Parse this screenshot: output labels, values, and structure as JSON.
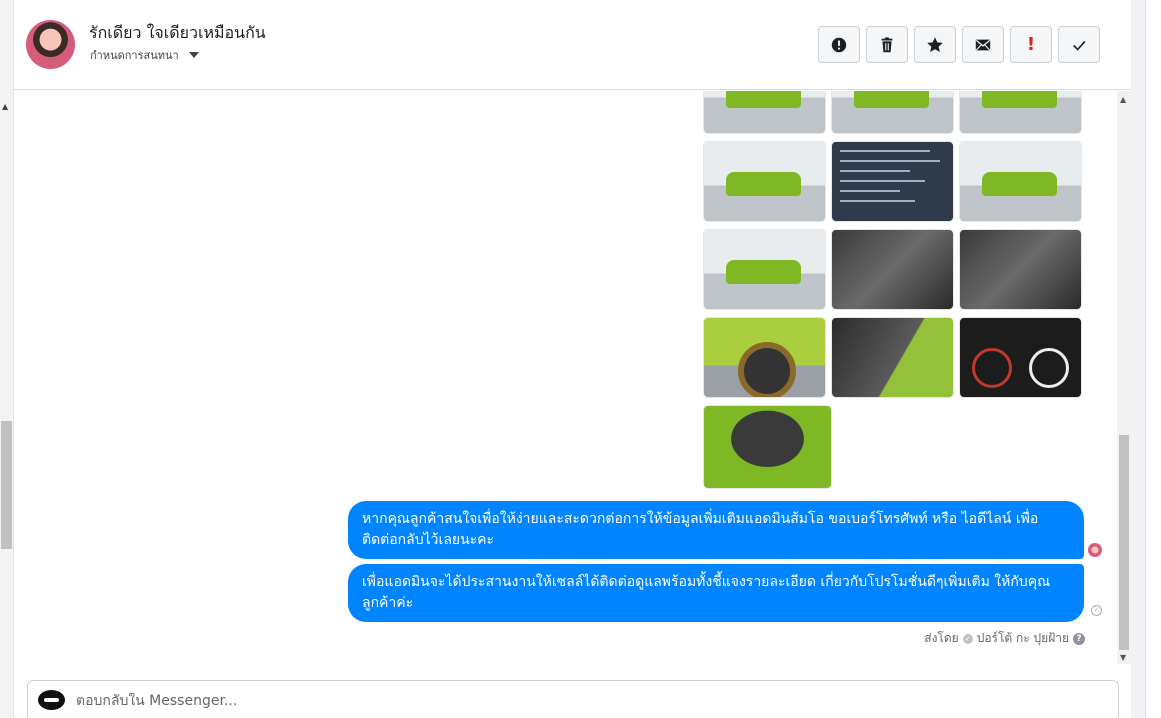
{
  "header": {
    "contact_name": "รักเดียว ใจเดียวเหมือนกัน",
    "conversation_settings": "กำหนดการสนทนา",
    "actions": [
      {
        "name": "mark-spam-button",
        "icon": "alert-circle-icon"
      },
      {
        "name": "delete-button",
        "icon": "trash-icon"
      },
      {
        "name": "star-button",
        "icon": "star-icon"
      },
      {
        "name": "mark-unread-button",
        "icon": "envelope-icon"
      },
      {
        "name": "follow-up-button",
        "icon": "exclamation-icon",
        "label": "!"
      },
      {
        "name": "mark-done-button",
        "icon": "check-icon"
      }
    ]
  },
  "messages": [
    {
      "text": "หากคุณลูกค้าสนใจเพื่อให้ง่ายและสะดวกต่อการให้ข้อมูลเพิ่มเติมแอดมินส้มโอ ขอเบอร์โทรศัพท์ หรือ ไอดีไลน์ เพื่อติดต่อกลับไว้เลยนะคะ"
    },
    {
      "text": "เพื่อแอดมินจะได้ประสานงานให้เซลล์ได้ติดต่อดูแลพร้อมทั้งชี้แจงรายละเอียด เกี่ยวกับโปรโมชั่นดีๆเพิ่มเติม ให้กับคุณลูกค้าค่ะ"
    }
  ],
  "sent_by": {
    "prefix": "ส่งโดย",
    "name": "ปอร์โต้ กะ ปุยฝ้าย"
  },
  "reply": {
    "placeholder": "ตอบกลับใน Messenger..."
  },
  "photos": [
    {
      "kind": "green-car",
      "subject": "car front view"
    },
    {
      "kind": "green-car",
      "subject": "car front view"
    },
    {
      "kind": "green-car",
      "subject": "car front view"
    },
    {
      "kind": "green-car",
      "subject": "car rear view"
    },
    {
      "kind": "spec-sheet",
      "subject": "specification sheet"
    },
    {
      "kind": "green-car",
      "subject": "car side view"
    },
    {
      "kind": "green-car",
      "subject": "car side view"
    },
    {
      "kind": "interior",
      "subject": "gear shift interior"
    },
    {
      "kind": "interior",
      "subject": "dashboard interior"
    },
    {
      "kind": "wheel",
      "subject": "wheel close-up"
    },
    {
      "kind": "door",
      "subject": "door panel"
    },
    {
      "kind": "dash",
      "subject": "instrument cluster"
    },
    {
      "kind": "engine",
      "subject": "engine bay"
    }
  ],
  "colors": {
    "bubble": "#0084ff",
    "accent_red": "#e4211b"
  }
}
